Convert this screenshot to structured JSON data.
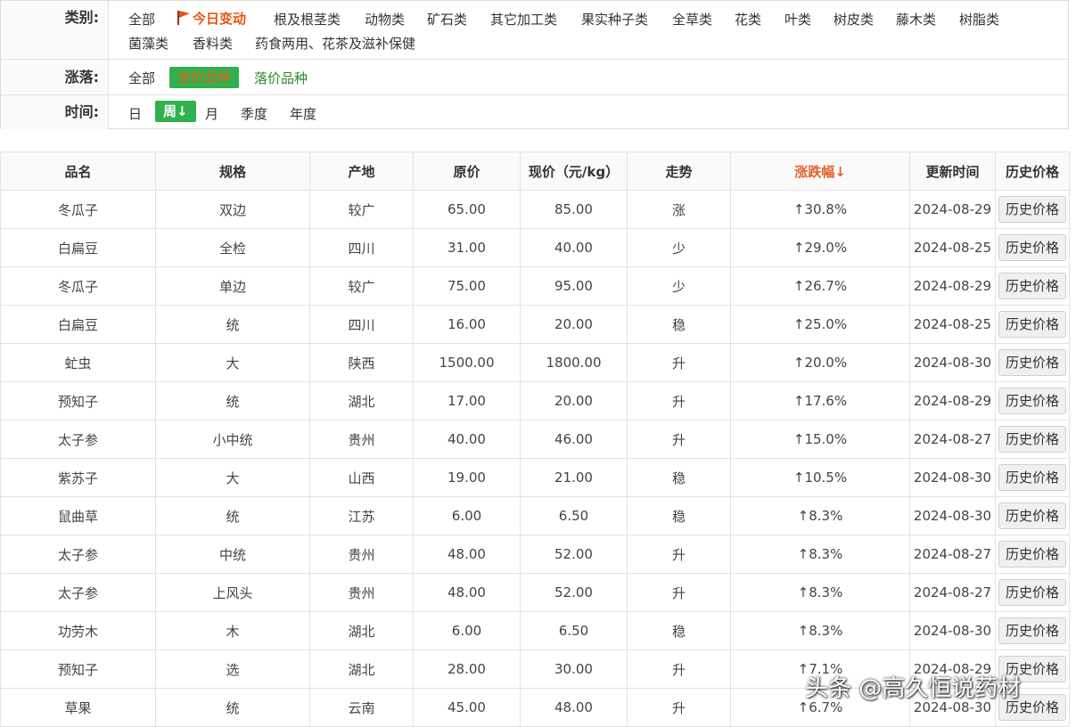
{
  "filters": {
    "category": {
      "label": "类别:",
      "row1": [
        "全部",
        "今日变动",
        "根及根茎类",
        "动物类",
        "矿石类",
        "其它加工类",
        "果实种子类",
        "全草类",
        "花类",
        "叶类",
        "树皮类",
        "藤木类",
        "树脂类"
      ],
      "row2": [
        "菌藻类",
        "香料类",
        "药食两用、花茶及滋补保健"
      ]
    },
    "change": {
      "label": "涨落:",
      "options": [
        "全部",
        "涨价品种",
        "落价品种"
      ]
    },
    "time": {
      "label": "时间:",
      "options": [
        "日",
        "周",
        "月",
        "季度",
        "年度"
      ],
      "selected_arrow": "↓"
    }
  },
  "colors": {
    "accent_green": "#2fb14d",
    "rise_orange": "#ee6a2b",
    "hot_red": "#e95513"
  },
  "table": {
    "headers": [
      "品名",
      "规格",
      "产地",
      "原价",
      "现价（元/kg）",
      "走势",
      "涨跌幅↓",
      "更新时间",
      "历史价格"
    ],
    "button_label": "历史价格",
    "rows": [
      {
        "name": "冬瓜子",
        "spec": "双边",
        "origin": "较广",
        "old": "65.00",
        "new": "85.00",
        "trend": "涨",
        "change": "↑30.8%",
        "date": "2024-08-29"
      },
      {
        "name": "白扁豆",
        "spec": "全检",
        "origin": "四川",
        "old": "31.00",
        "new": "40.00",
        "trend": "少",
        "change": "↑29.0%",
        "date": "2024-08-25"
      },
      {
        "name": "冬瓜子",
        "spec": "单边",
        "origin": "较广",
        "old": "75.00",
        "new": "95.00",
        "trend": "少",
        "change": "↑26.7%",
        "date": "2024-08-29"
      },
      {
        "name": "白扁豆",
        "spec": "统",
        "origin": "四川",
        "old": "16.00",
        "new": "20.00",
        "trend": "稳",
        "change": "↑25.0%",
        "date": "2024-08-25"
      },
      {
        "name": "虻虫",
        "spec": "大",
        "origin": "陕西",
        "old": "1500.00",
        "new": "1800.00",
        "trend": "升",
        "change": "↑20.0%",
        "date": "2024-08-30"
      },
      {
        "name": "预知子",
        "spec": "统",
        "origin": "湖北",
        "old": "17.00",
        "new": "20.00",
        "trend": "升",
        "change": "↑17.6%",
        "date": "2024-08-29"
      },
      {
        "name": "太子参",
        "spec": "小中统",
        "origin": "贵州",
        "old": "40.00",
        "new": "46.00",
        "trend": "升",
        "change": "↑15.0%",
        "date": "2024-08-27"
      },
      {
        "name": "紫苏子",
        "spec": "大",
        "origin": "山西",
        "old": "19.00",
        "new": "21.00",
        "trend": "稳",
        "change": "↑10.5%",
        "date": "2024-08-30"
      },
      {
        "name": "鼠曲草",
        "spec": "统",
        "origin": "江苏",
        "old": "6.00",
        "new": "6.50",
        "trend": "稳",
        "change": "↑8.3%",
        "date": "2024-08-30"
      },
      {
        "name": "太子参",
        "spec": "中统",
        "origin": "贵州",
        "old": "48.00",
        "new": "52.00",
        "trend": "升",
        "change": "↑8.3%",
        "date": "2024-08-27"
      },
      {
        "name": "太子参",
        "spec": "上风头",
        "origin": "贵州",
        "old": "48.00",
        "new": "52.00",
        "trend": "升",
        "change": "↑8.3%",
        "date": "2024-08-27"
      },
      {
        "name": "功劳木",
        "spec": "木",
        "origin": "湖北",
        "old": "6.00",
        "new": "6.50",
        "trend": "稳",
        "change": "↑8.3%",
        "date": "2024-08-30"
      },
      {
        "name": "预知子",
        "spec": "选",
        "origin": "湖北",
        "old": "28.00",
        "new": "30.00",
        "trend": "升",
        "change": "↑7.1%",
        "date": "2024-08-29"
      },
      {
        "name": "草果",
        "spec": "统",
        "origin": "云南",
        "old": "45.00",
        "new": "48.00",
        "trend": "升",
        "change": "↑6.7%",
        "date": "2024-08-30"
      }
    ]
  },
  "watermark": "头条 @高久恒说药材"
}
